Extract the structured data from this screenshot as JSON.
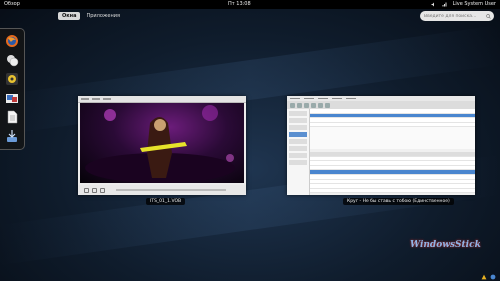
{
  "panel": {
    "activities": "Обзор",
    "clock": "Пт 13:08",
    "user": "Live System User"
  },
  "overview": {
    "tabs": [
      {
        "label": "Окна",
        "active": true
      },
      {
        "label": "Приложения",
        "active": false
      }
    ],
    "search_placeholder": "Введите для поиска..."
  },
  "dash": {
    "items": [
      {
        "name": "firefox-icon"
      },
      {
        "name": "empathy-icon"
      },
      {
        "name": "rhythmbox-icon"
      },
      {
        "name": "shotwell-icon"
      },
      {
        "name": "document-icon"
      },
      {
        "name": "installer-icon"
      }
    ]
  },
  "windows": [
    {
      "caption": "ITS_01_1.VOB"
    },
    {
      "caption": "Круг - Не бы ставь с тобою (Единственное)"
    }
  ],
  "watermark": "WindowsStick",
  "colors": {
    "panel": "#000000",
    "wallpaper": "#0f1c2c",
    "accent": "#4a86cf"
  }
}
